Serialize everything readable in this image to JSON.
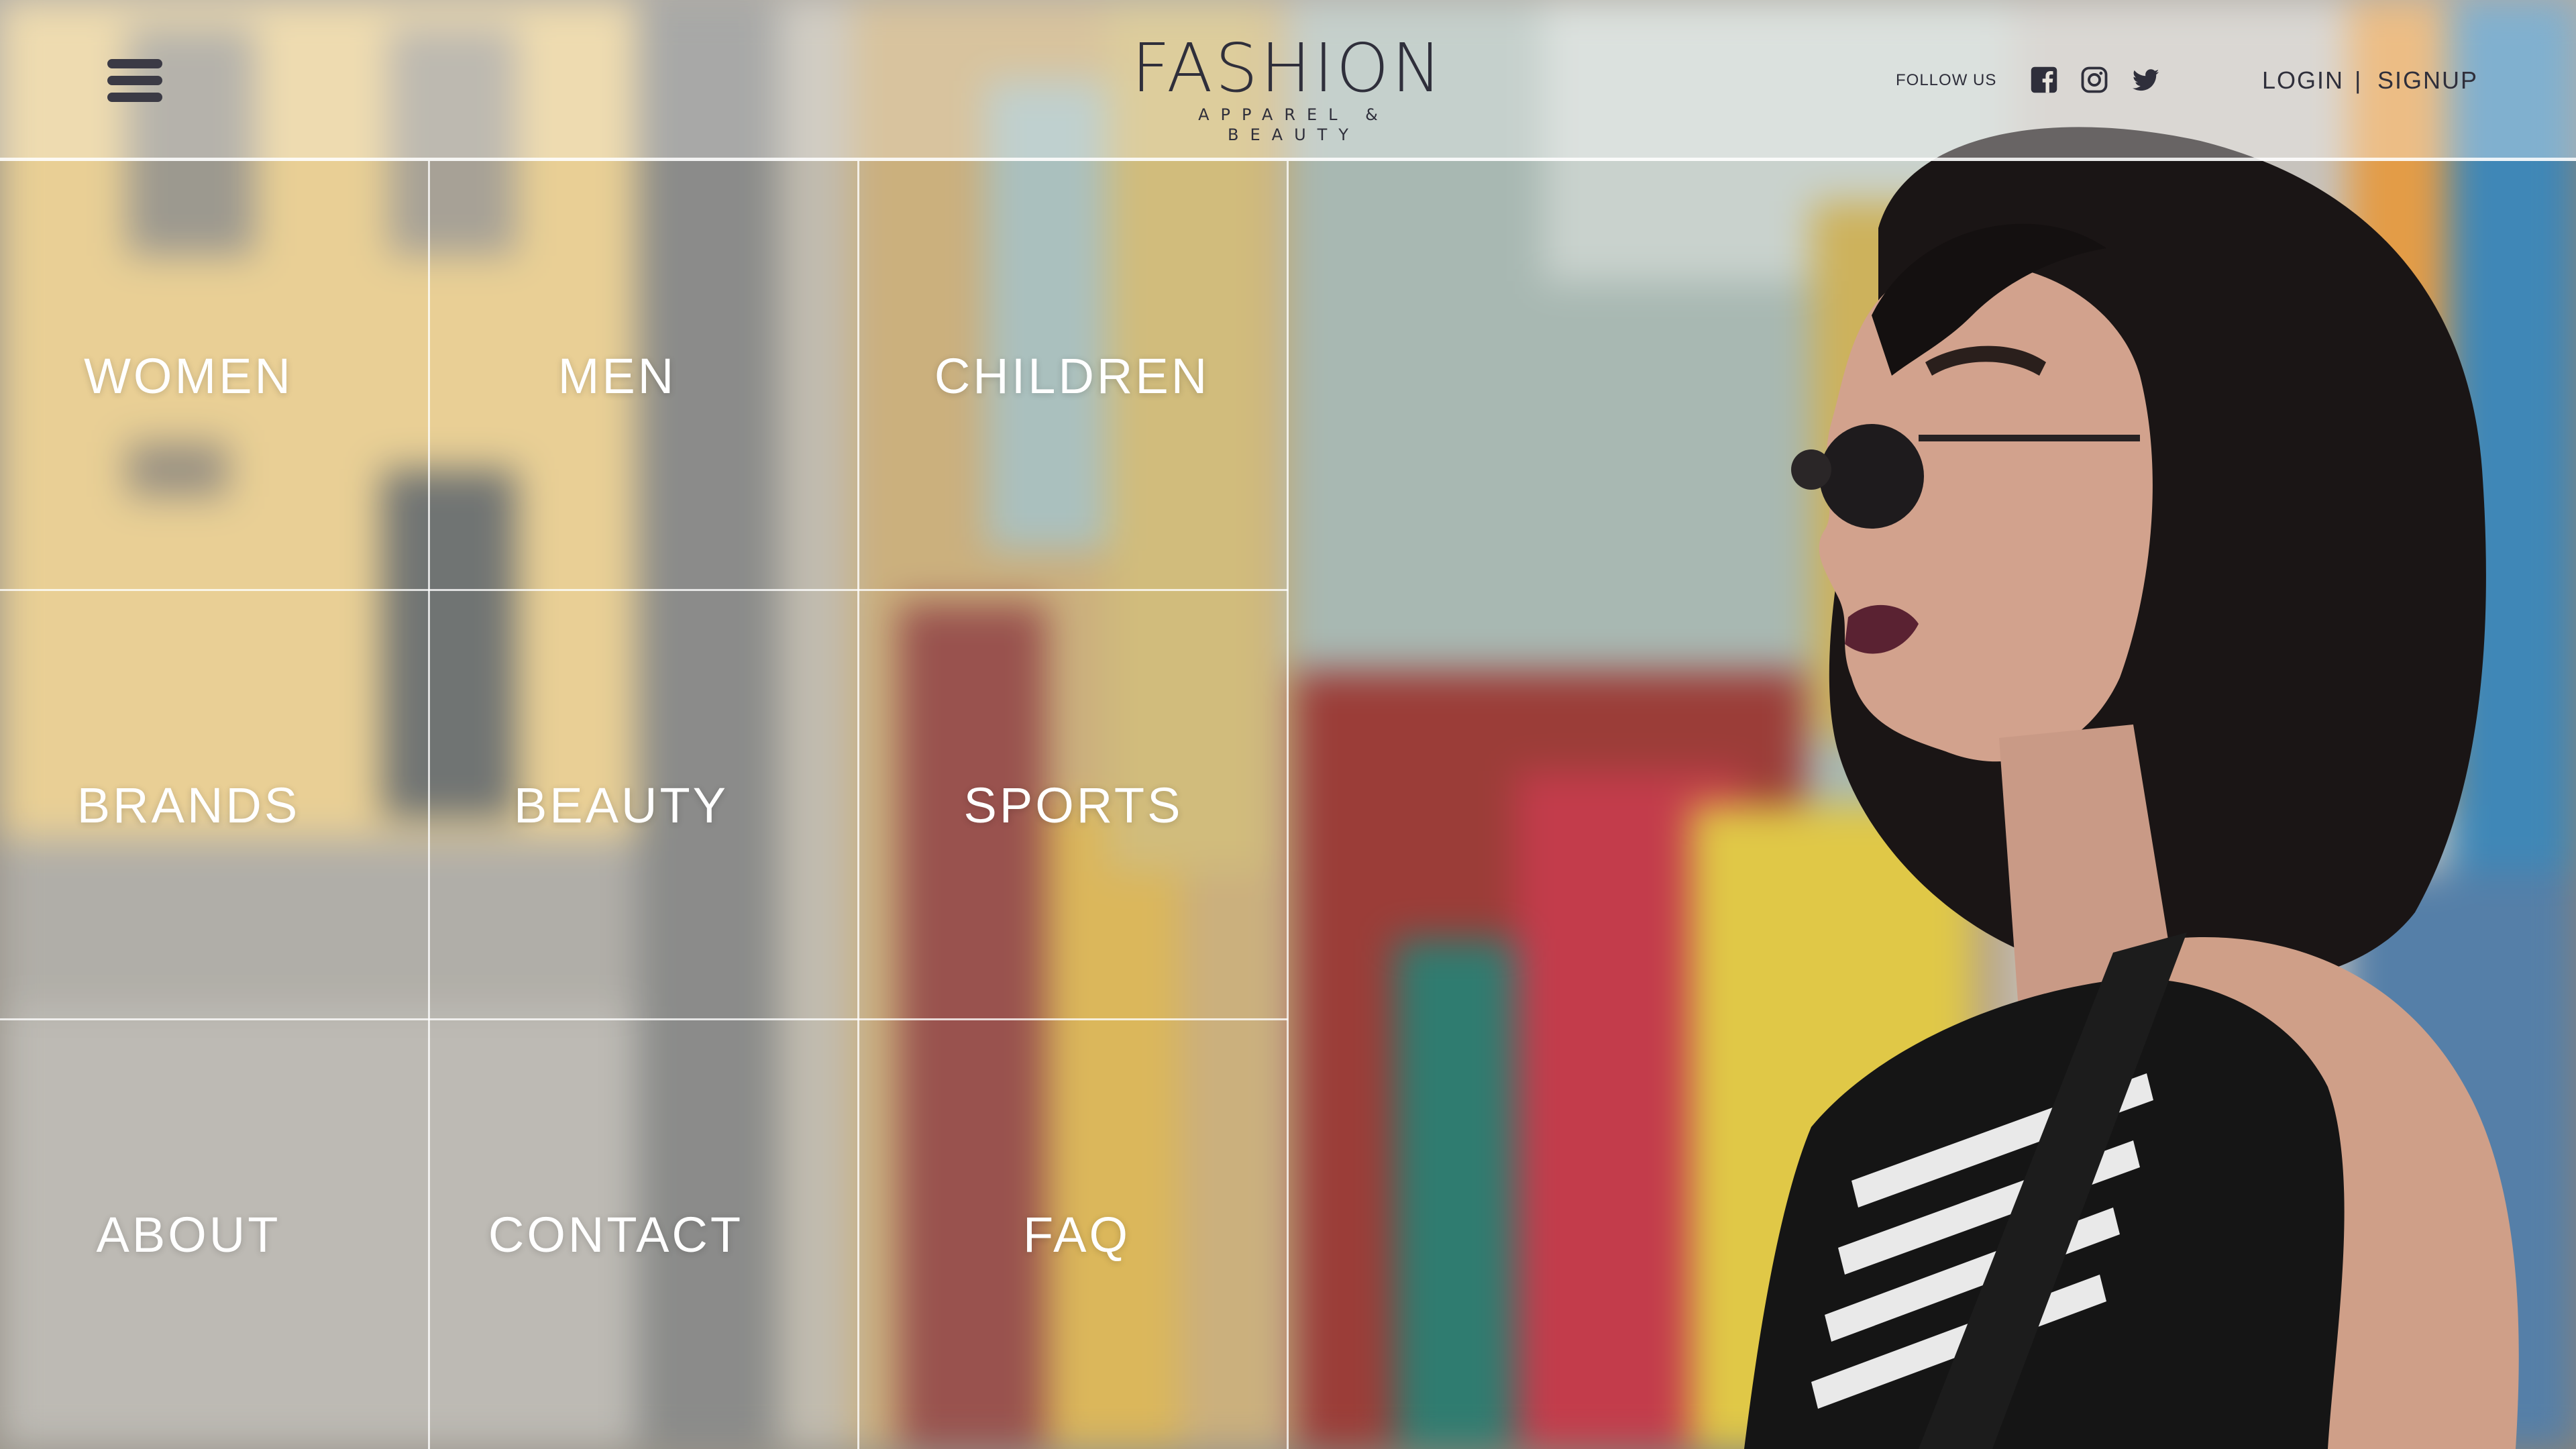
{
  "header": {
    "menu_icon": "hamburger-menu-icon",
    "logo": {
      "title": "FASHION",
      "subtitle": "APPAREL & BEAUTY"
    },
    "follow_label": "FOLLOW US",
    "social": [
      {
        "name": "facebook",
        "icon": "facebook-icon"
      },
      {
        "name": "instagram",
        "icon": "instagram-icon"
      },
      {
        "name": "twitter",
        "icon": "twitter-icon"
      }
    ],
    "login_label": "LOGIN",
    "separator": "|",
    "signup_label": "SIGNUP"
  },
  "menu": {
    "items": [
      {
        "label": "WOMEN"
      },
      {
        "label": "MEN"
      },
      {
        "label": "CHILDREN"
      },
      {
        "label": "BRANDS"
      },
      {
        "label": "BEAUTY"
      },
      {
        "label": "SPORTS"
      },
      {
        "label": "ABOUT"
      },
      {
        "label": "CONTACT"
      },
      {
        "label": "FAQ"
      }
    ]
  },
  "colors": {
    "text_dark": "#2f2f3b",
    "menu_text": "#ffffff",
    "grid_lines": "#ffffff"
  }
}
